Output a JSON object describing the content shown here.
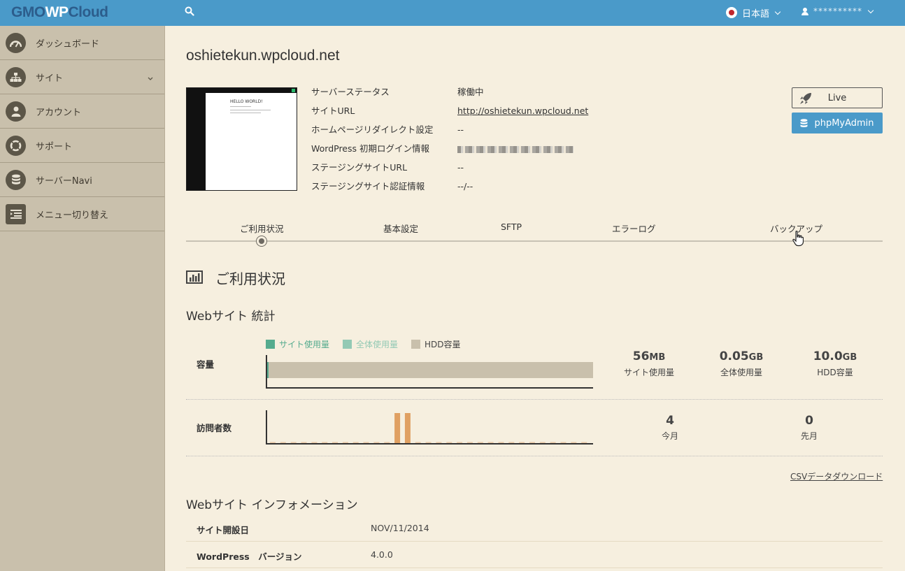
{
  "header": {
    "logo_prefix": "GMO",
    "logo_mid": "WP",
    "logo_suffix": "Cloud",
    "language": "日本語",
    "user": "**********"
  },
  "sidebar": {
    "items": [
      {
        "label": "ダッシュボード",
        "icon": "dashboard-icon"
      },
      {
        "label": "サイト",
        "icon": "sitemap-icon",
        "expandable": true
      },
      {
        "label": "アカウント",
        "icon": "user-icon"
      },
      {
        "label": "サポート",
        "icon": "lifebuoy-icon"
      },
      {
        "label": "サーバーNavi",
        "icon": "database-icon"
      },
      {
        "label": "メニュー切り替え",
        "icon": "menu-toggle-icon"
      }
    ]
  },
  "site": {
    "title": "oshietekun.wpcloud.net",
    "thumb_text": "HELLO WORLD!",
    "info": [
      {
        "label": "サーバーステータス",
        "value": "稼働中"
      },
      {
        "label": "サイトURL",
        "value": "http://oshietekun.wpcloud.net",
        "link": true
      },
      {
        "label": "ホームページリダイレクト設定",
        "value": "--"
      },
      {
        "label": "WordPress 初期ログイン情報",
        "value": "",
        "masked": true
      },
      {
        "label": "ステージングサイトURL",
        "value": "--"
      },
      {
        "label": "ステージングサイト認証情報",
        "value": "--/--"
      }
    ],
    "live_button": "Live",
    "phpmyadmin_button": "phpMyAdmin"
  },
  "tabs": [
    "ご利用状況",
    "基本設定",
    "SFTP",
    "エラーログ",
    "バックアップ"
  ],
  "usage": {
    "section_title": "ご利用状況",
    "stats_title": "Webサイト 統計",
    "legend": [
      {
        "label": "サイト使用量",
        "color": "#55ab8e"
      },
      {
        "label": "全体使用量",
        "color": "#93c9b4"
      },
      {
        "label": "HDD容量",
        "color": "#c9c0ac"
      }
    ],
    "capacity_label": "容量",
    "capacity": {
      "site_usage_num": "56",
      "site_usage_unit": "MB",
      "site_usage_label": "サイト使用量",
      "total_usage_num": "0.05",
      "total_usage_unit": "GB",
      "total_usage_label": "全体使用量",
      "hdd_num": "10.0",
      "hdd_unit": "GB",
      "hdd_label": "HDD容量"
    },
    "visitors_label": "訪問者数",
    "visitors": {
      "this_month": "4",
      "this_month_label": "今月",
      "last_month": "0",
      "last_month_label": "先月"
    },
    "csv_link": "CSVデータダウンロード"
  },
  "chart_data": [
    {
      "type": "bar",
      "title": "容量",
      "series": [
        {
          "name": "サイト使用量",
          "values": [
            0.056
          ]
        },
        {
          "name": "全体使用量",
          "values": [
            0.05
          ]
        },
        {
          "name": "HDD容量",
          "values": [
            10.0
          ]
        }
      ],
      "unit": "GB",
      "ylim": [
        0,
        10.0
      ]
    },
    {
      "type": "bar",
      "title": "訪問者数",
      "values": [
        0,
        0,
        0,
        0,
        0,
        0,
        0,
        0,
        0,
        0,
        0,
        0,
        2,
        2,
        0,
        0,
        0,
        0,
        0,
        0,
        0,
        0,
        0,
        0,
        0,
        0,
        0,
        0,
        0,
        0,
        0
      ],
      "ylim": [
        0,
        2
      ]
    }
  ],
  "site_info": {
    "title": "Webサイト インフォメーション",
    "rows": [
      {
        "label": "サイト開設日",
        "value": "NOV/11/2014"
      },
      {
        "label": "WordPress　バージョン",
        "value": "4.0.0"
      }
    ]
  }
}
